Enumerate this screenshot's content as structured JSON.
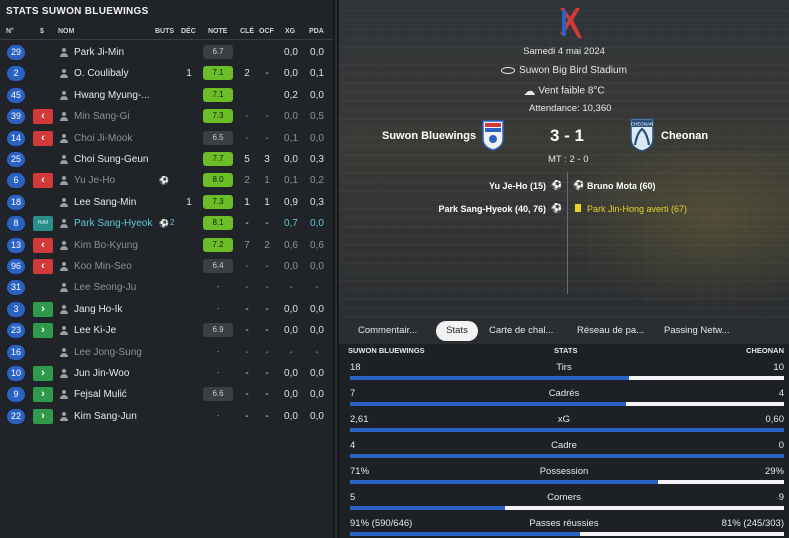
{
  "left_panel": {
    "title": "STATS SUWON BLUEWINGS",
    "headers": {
      "num": "N°",
      "sub": "$",
      "name": "NOM",
      "buts": "BUTS",
      "dec": "DÉC",
      "note": "NOTE",
      "cle": "CLÉ",
      "ocf": "OCF",
      "xg": "XG",
      "pda": "PDA"
    },
    "players": [
      {
        "num": "29",
        "sub": "",
        "name": "Park Ji-Min",
        "goals": "",
        "dec": "",
        "note": "6.7",
        "note_style": "grey",
        "cle": "",
        "ocf": "",
        "xg": "0,0",
        "pda": "0,0",
        "state": "normal"
      },
      {
        "num": "2",
        "sub": "",
        "name": "O. Coulibaly",
        "goals": "",
        "dec": "1",
        "note": "7.1",
        "note_style": "green",
        "cle": "2",
        "ocf": "-",
        "xg": "0,0",
        "pda": "0,1",
        "state": "normal"
      },
      {
        "num": "45",
        "sub": "",
        "name": "Hwang Myung-...",
        "goals": "",
        "dec": "",
        "note": "7.1",
        "note_style": "green",
        "cle": "",
        "ocf": "",
        "xg": "0,2",
        "pda": "0,0",
        "state": "normal"
      },
      {
        "num": "39",
        "sub": "out",
        "name": "Min Sang-Gi",
        "goals": "",
        "dec": "",
        "note": "7.3",
        "note_style": "green",
        "cle": "-",
        "ocf": "-",
        "xg": "0,0",
        "pda": "0,5",
        "state": "dim"
      },
      {
        "num": "14",
        "sub": "out",
        "name": "Choi Ji-Mook",
        "goals": "",
        "dec": "",
        "note": "6.5",
        "note_style": "grey",
        "cle": "-",
        "ocf": "-",
        "xg": "0,1",
        "pda": "0,0",
        "state": "dim"
      },
      {
        "num": "25",
        "sub": "",
        "name": "Choi Sung-Geun",
        "goals": "",
        "dec": "",
        "note": "7.7",
        "note_style": "green",
        "cle": "5",
        "ocf": "3",
        "xg": "0,0",
        "pda": "0,3",
        "state": "normal"
      },
      {
        "num": "6",
        "sub": "out",
        "name": "Yu Je-Ho",
        "goals": "⚽",
        "goals_count": "",
        "dec": "",
        "note": "8.0",
        "note_style": "green",
        "cle": "2",
        "ocf": "1",
        "xg": "0,1",
        "pda": "0,2",
        "state": "dim"
      },
      {
        "num": "18",
        "sub": "",
        "name": "Lee Sang-Min",
        "goals": "",
        "dec": "1",
        "note": "7.3",
        "note_style": "green",
        "cle": "1",
        "ocf": "1",
        "xg": "0,9",
        "pda": "0,3",
        "state": "normal"
      },
      {
        "num": "8",
        "sub": "hdm",
        "sub_label": "HdM",
        "name": "Park Sang-Hyeok",
        "goals": "⚽",
        "goals_count": "2",
        "dec": "",
        "note": "8.1",
        "note_style": "green",
        "cle": "-",
        "ocf": "-",
        "xg": "0,7",
        "pda": "0,0",
        "state": "highlight"
      },
      {
        "num": "13",
        "sub": "out",
        "name": "Kim Bo-Kyung",
        "goals": "",
        "dec": "",
        "note": "7.2",
        "note_style": "green",
        "cle": "7",
        "ocf": "2",
        "xg": "0,6",
        "pda": "0,6",
        "state": "dim"
      },
      {
        "num": "96",
        "sub": "out",
        "name": "Koo Min-Seo",
        "goals": "",
        "dec": "",
        "note": "6.4",
        "note_style": "grey",
        "cle": "-",
        "ocf": "-",
        "xg": "0,0",
        "pda": "0,0",
        "state": "dim"
      },
      {
        "num": "31",
        "sub": "",
        "name": "Lee Seong-Ju",
        "goals": "",
        "dec": "",
        "note": "-",
        "note_style": "empty",
        "cle": "-",
        "ocf": "-",
        "xg": "-",
        "pda": "-",
        "state": "dim"
      },
      {
        "num": "3",
        "sub": "in",
        "name": "Jang Ho-Ik",
        "goals": "",
        "dec": "",
        "note": "-",
        "note_style": "empty",
        "cle": "-",
        "ocf": "-",
        "xg": "0,0",
        "pda": "0,0",
        "state": "normal"
      },
      {
        "num": "23",
        "sub": "in",
        "name": "Lee Ki-Je",
        "goals": "",
        "dec": "",
        "note": "6.9",
        "note_style": "grey",
        "cle": "-",
        "ocf": "-",
        "xg": "0,0",
        "pda": "0,0",
        "state": "normal"
      },
      {
        "num": "16",
        "sub": "",
        "name": "Lee Jong-Sung",
        "goals": "",
        "dec": "",
        "note": "-",
        "note_style": "empty",
        "cle": "-",
        "ocf": "-",
        "xg": "-",
        "pda": "-",
        "state": "dim"
      },
      {
        "num": "10",
        "sub": "in",
        "name": "Jun Jin-Woo",
        "goals": "",
        "dec": "",
        "note": "-",
        "note_style": "empty",
        "cle": "-",
        "ocf": "-",
        "xg": "0,0",
        "pda": "0,0",
        "state": "normal"
      },
      {
        "num": "9",
        "sub": "in",
        "name": "Fejsal Mulić",
        "goals": "",
        "dec": "",
        "note": "6.6",
        "note_style": "grey",
        "cle": "-",
        "ocf": "-",
        "xg": "0,0",
        "pda": "0,0",
        "state": "normal"
      },
      {
        "num": "22",
        "sub": "in",
        "name": "Kim Sang-Jun",
        "goals": "",
        "dec": "",
        "note": "-",
        "note_style": "empty",
        "cle": "-",
        "ocf": "-",
        "xg": "0,0",
        "pda": "0,0",
        "state": "normal"
      }
    ]
  },
  "match": {
    "date": "Samedi 4 mai 2024",
    "stadium": "Suwon Big Bird Stadium",
    "weather": "Vent faible 8°C",
    "attendance": "Attendance: 10,360",
    "home_team": "Suwon Bluewings",
    "away_team": "Cheonan",
    "away_crest_text": "CHEONAN",
    "score": "3 - 1",
    "halftime": "MT : 2 - 0",
    "home_events": [
      "Yu Je-Ho (15)",
      "Park Sang-Hyeok (40, 76)"
    ],
    "away_events": [
      "Bruno Mota (60)",
      "Park Jin-Hong averti (67)"
    ]
  },
  "tabs": [
    "Commentair...",
    "Stats",
    "Carte de chal...",
    "Réseau de pa...",
    "Passing Netw..."
  ],
  "active_tab": "Stats",
  "stats": {
    "home_header": "SUWON BLUEWINGS",
    "center_header": "STATS",
    "away_header": "CHEONAN",
    "rows": [
      {
        "label": "Tirs",
        "home": "18",
        "away": "10",
        "home_share": 0.643
      },
      {
        "label": "Cadrés",
        "home": "7",
        "away": "4",
        "home_share": 0.636
      },
      {
        "label": "xG",
        "home": "2,61",
        "away": "0,60",
        "home_share": 1.0
      },
      {
        "label": "Cadre",
        "home": "4",
        "away": "0",
        "home_share": 1.0
      },
      {
        "label": "Possession",
        "home": "71%",
        "away": "29%",
        "home_share": 0.71
      },
      {
        "label": "Corners",
        "home": "5",
        "away": "9",
        "home_share": 0.357
      },
      {
        "label": "Passes réussies",
        "home": "91% (590/646)",
        "away": "81% (245/303)",
        "home_share": 0.53
      }
    ]
  },
  "colors": {
    "accent_blue": "#2a62c4",
    "rating_green": "#6cbe28",
    "sub_out": "#d23a3a",
    "sub_in": "#2f9a4a",
    "highlight": "#5fc8d8"
  }
}
